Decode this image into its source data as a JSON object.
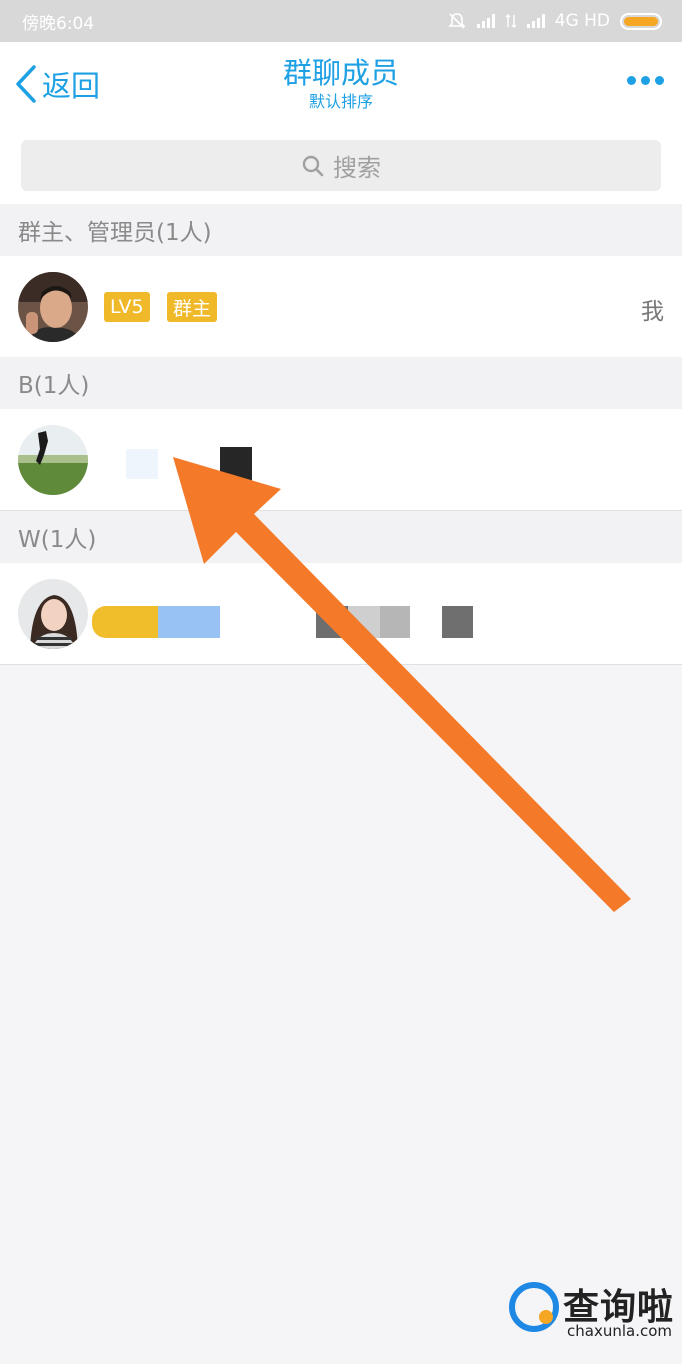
{
  "status_bar": {
    "time": "傍晚6:04",
    "network": "4G HD"
  },
  "nav": {
    "back_label": "返回",
    "title": "群聊成员",
    "subtitle": "默认排序"
  },
  "search": {
    "placeholder": "搜索"
  },
  "sections": [
    {
      "header": "群主、管理员(1人)",
      "members": [
        {
          "level_badge": "LV5",
          "role_badge": "群主",
          "right_label": "我"
        }
      ]
    },
    {
      "header": "B(1人)"
    },
    {
      "header": "W(1人)"
    }
  ],
  "watermark": {
    "name": "查询啦",
    "url": "chaxunla.com"
  },
  "colors": {
    "accent": "#1ea0e4",
    "badge": "#f0b92a",
    "arrow": "#f47a2a",
    "battery": "#f5a623"
  }
}
